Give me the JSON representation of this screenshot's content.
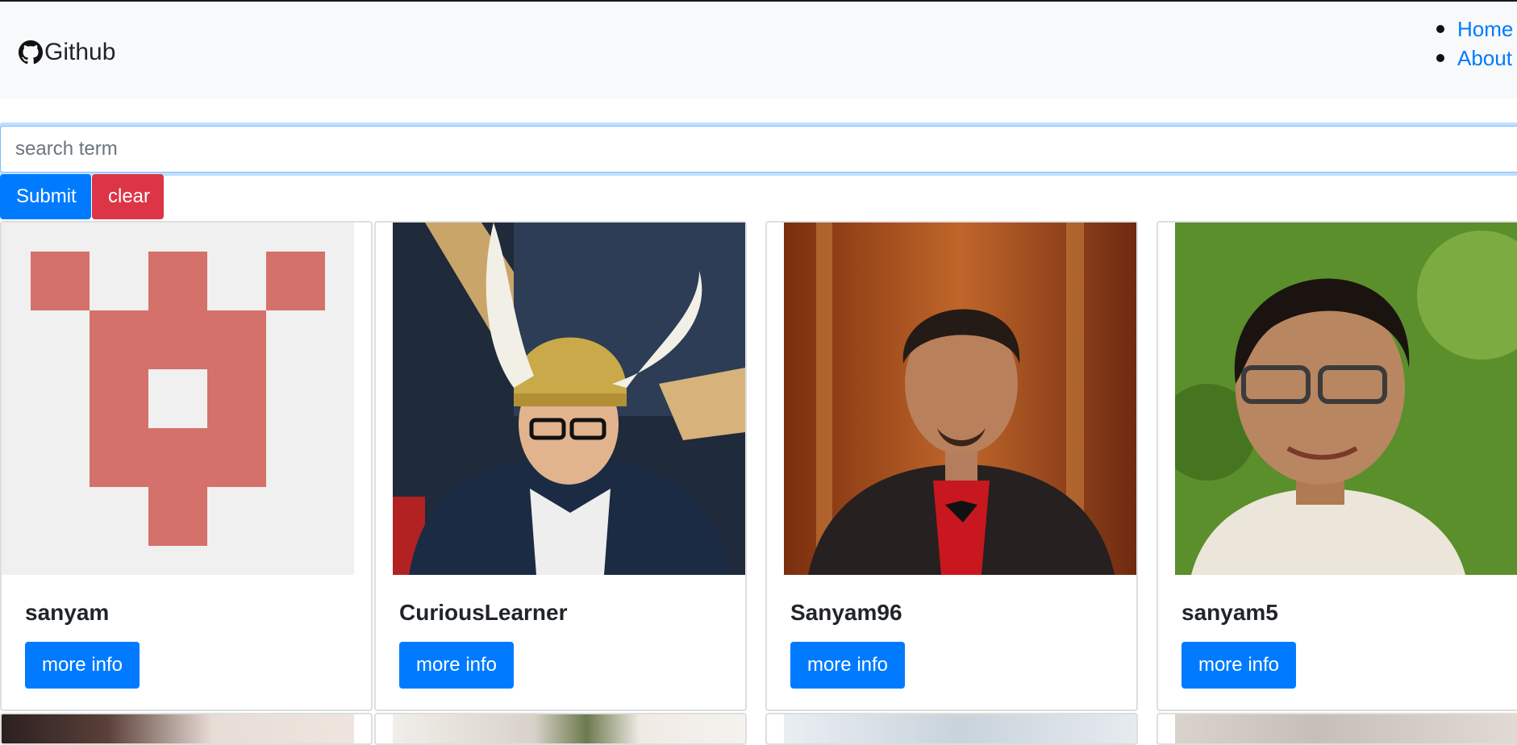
{
  "navbar": {
    "brand_icon": "github-icon",
    "brand_label": "Github",
    "links": [
      {
        "label": "Home"
      },
      {
        "label": "About"
      }
    ],
    "link_color": "#007bff"
  },
  "search": {
    "value": "",
    "placeholder": "search term",
    "submit_label": "Submit",
    "clear_label": "clear"
  },
  "colors": {
    "primary": "#007bff",
    "danger": "#dc3545",
    "navbar_bg": "#f8f9fa"
  },
  "users": [
    {
      "username": "sanyam",
      "button_label": "more info",
      "avatar": "identicon-avatar"
    },
    {
      "username": "CuriousLearner",
      "button_label": "more info",
      "avatar": "photo-avatar"
    },
    {
      "username": "Sanyam96",
      "button_label": "more info",
      "avatar": "photo-avatar"
    },
    {
      "username": "sanyam5",
      "button_label": "more info",
      "avatar": "photo-avatar"
    }
  ]
}
